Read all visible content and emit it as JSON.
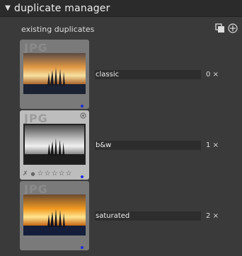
{
  "header": {
    "title": "duplicate manager",
    "arrow_icon": "triangle-down-icon"
  },
  "subheader": {
    "label": "existing duplicates",
    "tools": [
      "duplicate-icon",
      "add-circle-icon"
    ]
  },
  "duplicates": [
    {
      "ext": "JPG",
      "name": "classic",
      "count": "0",
      "count_suffix": "×",
      "selected": false
    },
    {
      "ext": "JPG",
      "name": "b&w",
      "count": "1",
      "count_suffix": "×",
      "selected": true
    },
    {
      "ext": "JPG",
      "name": "saturated",
      "count": "2",
      "count_suffix": "×",
      "selected": false
    }
  ],
  "colors": {
    "panel_bg": "#3a3a3a",
    "header_bg": "#2b2b2b",
    "field_bg": "#2d2d2d",
    "marker": "#1f2bd6"
  }
}
